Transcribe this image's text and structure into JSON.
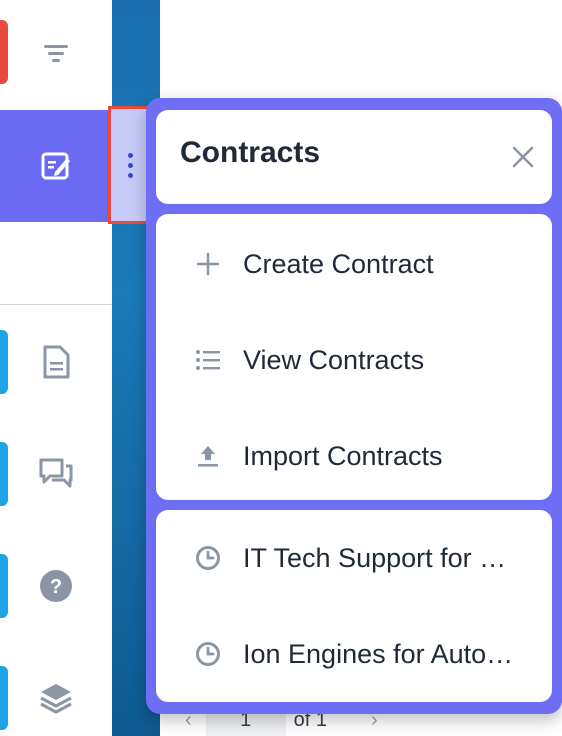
{
  "panel": {
    "title": "Contracts",
    "actions": [
      {
        "label": "Create Contract",
        "icon": "plus-icon"
      },
      {
        "label": "View Contracts",
        "icon": "list-icon"
      },
      {
        "label": "Import Contracts",
        "icon": "upload-icon"
      }
    ],
    "recent": [
      {
        "label": "IT Tech Support for …",
        "icon": "clock-icon"
      },
      {
        "label": "Ion Engines for Auto…",
        "icon": "clock-icon"
      }
    ]
  },
  "pager": {
    "page": "1",
    "of_label": "of 1"
  },
  "sidebar": {
    "items": [
      {
        "icon": "filter-icon"
      },
      {
        "icon": "edit-icon",
        "active": true
      },
      {
        "icon": "document-icon"
      },
      {
        "icon": "chat-icon"
      },
      {
        "icon": "help-icon"
      },
      {
        "icon": "layers-icon"
      }
    ]
  },
  "colors": {
    "panel_bg": "#6e6ef5",
    "active_item_bg": "#6a6af3",
    "accent_red": "#ea4a3e",
    "accent_blue": "#1ea4e6",
    "strip_blue": "#1a7bb8"
  }
}
